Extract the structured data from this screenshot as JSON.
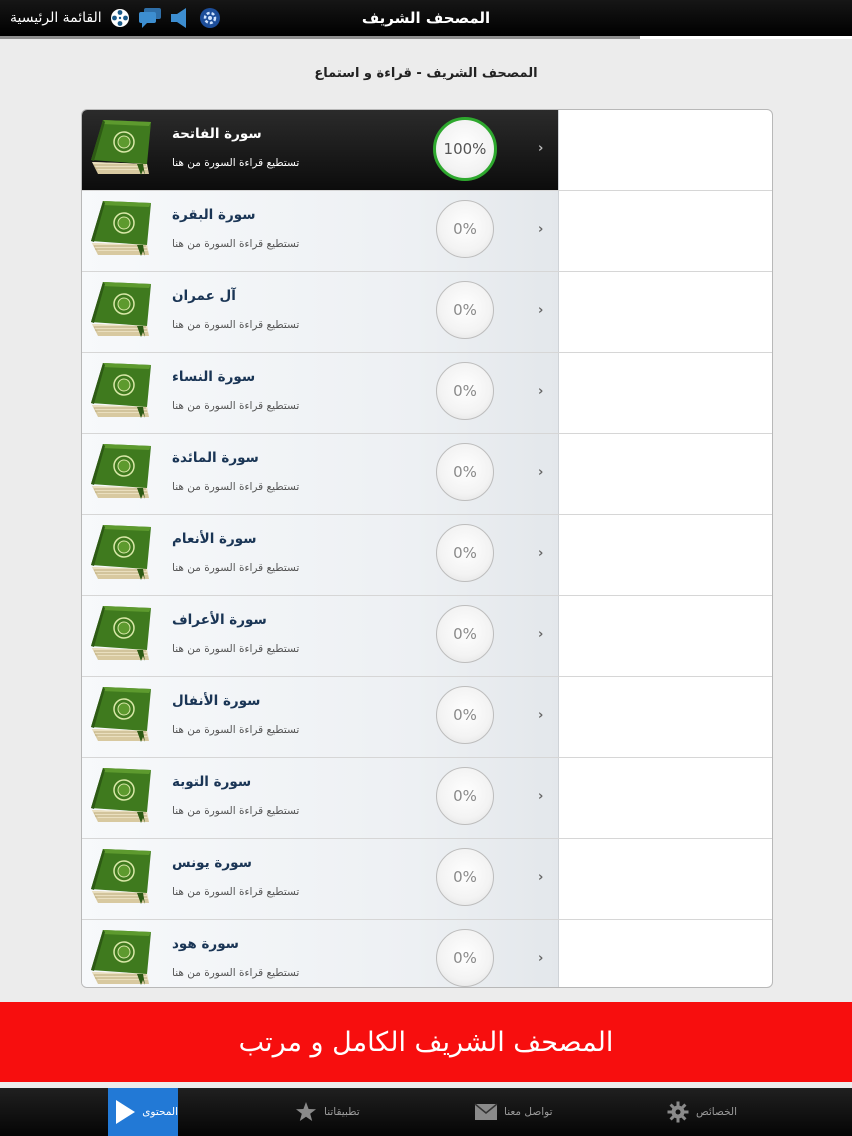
{
  "topbar": {
    "title": "المصحف الشريف",
    "menu_label": "القائمة الرئيسية",
    "icons": [
      "settings-badge-icon",
      "speaker-icon",
      "chat-icon",
      "film-reel-icon"
    ]
  },
  "subheading": "المصحف الشريف - قراءة و استماع",
  "surahs": [
    {
      "name": "سورة الفاتحة",
      "desc": "تستطيع قراءة السورة من هنا",
      "progress": "100%",
      "active": true
    },
    {
      "name": "سورة البقرة",
      "desc": "تستطيع قراءة السورة من هنا",
      "progress": "0%"
    },
    {
      "name": "آل عمران",
      "desc": "تستطيع قراءة السورة من هنا",
      "progress": "0%"
    },
    {
      "name": "سورة النساء",
      "desc": "تستطيع قراءة السورة من هنا",
      "progress": "0%"
    },
    {
      "name": "سورة المائدة",
      "desc": "تستطيع قراءة السورة من هنا",
      "progress": "0%"
    },
    {
      "name": "سورة الأنعام",
      "desc": "تستطيع قراءة السورة من هنا",
      "progress": "0%"
    },
    {
      "name": "سورة الأعراف",
      "desc": "تستطيع قراءة السورة من هنا",
      "progress": "0%"
    },
    {
      "name": "سورة الأنفال",
      "desc": "تستطيع قراءة السورة من هنا",
      "progress": "0%"
    },
    {
      "name": "سورة التوبة",
      "desc": "تستطيع قراءة السورة من هنا",
      "progress": "0%"
    },
    {
      "name": "سورة يونس",
      "desc": "تستطيع قراءة السورة من هنا",
      "progress": "0%"
    },
    {
      "name": "سورة هود",
      "desc": "تستطيع قراءة السورة من هنا",
      "progress": "0%"
    }
  ],
  "banner": "المصحف الشريف الكامل و مرتب",
  "tabs": [
    {
      "label": "المحتوى",
      "icon": "play-icon",
      "active": true
    },
    {
      "label": "تطبيقاتنا",
      "icon": "star-icon"
    },
    {
      "label": "تواصل معنا",
      "icon": "envelope-icon"
    },
    {
      "label": "الخصائص",
      "icon": "gear-icon"
    }
  ],
  "colors": {
    "accent_blue": "#2279d6",
    "banner_red": "#f70e0e",
    "progress_green": "#2ea82e",
    "book_green": "#3f7a1e"
  }
}
